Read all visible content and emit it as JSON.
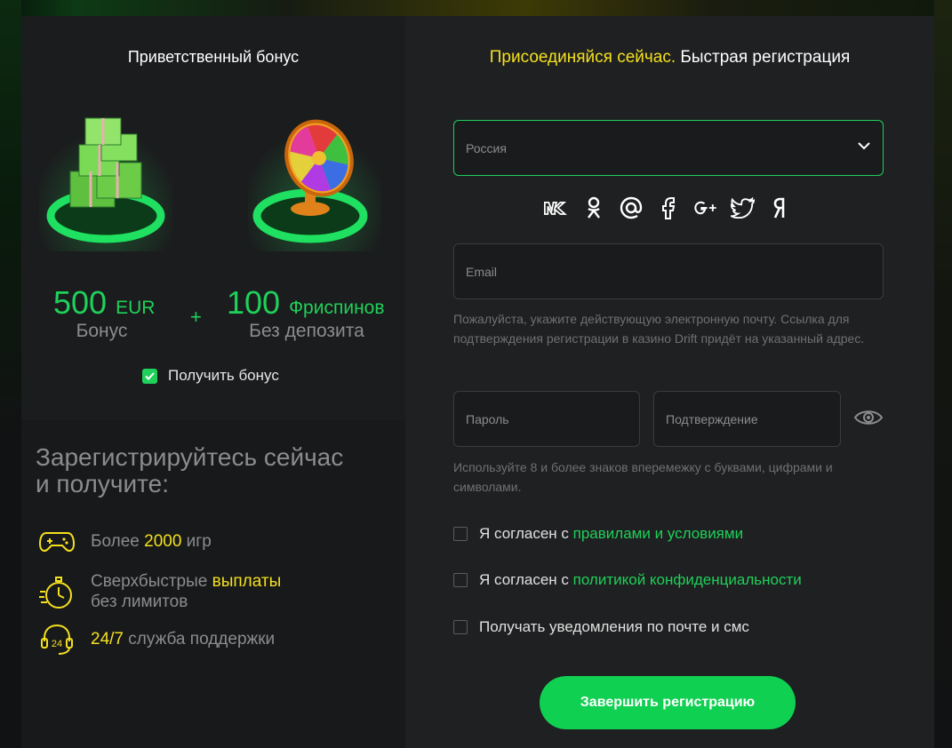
{
  "bonus": {
    "title": "Приветственный бонус",
    "bonus_amount": "500",
    "bonus_unit": "EUR",
    "bonus_sub": "Бонус",
    "plus": "+",
    "spins_amount": "100",
    "spins_unit": "Фриспинов",
    "spins_sub": "Без депозита",
    "get_bonus_label": "Получить бонус",
    "get_bonus_checked": true
  },
  "promo": {
    "title_line1": "Зарегистрируйтесь сейчас",
    "title_line2": "и получите:",
    "features": [
      {
        "icon": "gamepad-icon",
        "pre": "Более ",
        "highlight": "2000",
        "post": " игр"
      },
      {
        "icon": "stopwatch-icon",
        "pre": "Сверхбыстрые ",
        "highlight": "выплаты",
        "line2": "без лимитов"
      },
      {
        "icon": "support-24-icon",
        "highlight": "24/7",
        "post": " служба поддержки"
      }
    ]
  },
  "form": {
    "title_highlight": "Присоединяйся сейчас.",
    "title_rest": " Быстрая регистрация",
    "country_value": "Россия",
    "socials": [
      "vk-icon",
      "odnoklassniki-icon",
      "mailru-icon",
      "facebook-icon",
      "google-plus-icon",
      "twitter-icon",
      "yandex-icon"
    ],
    "email_placeholder": "Email",
    "email_hint": "Пожалуйста, укажите действующую электронную почту. Ссылка для подтверждения регистрации в казино Drift придёт на указанный адрес.",
    "password_placeholder": "Пароль",
    "confirm_placeholder": "Подтверждение",
    "password_hint": "Используйте 8 и более знаков вперемежку с буквами, цифрами и символами.",
    "agree_rules_pre": "Я согласен с ",
    "agree_rules_link": "правилами и условиями",
    "agree_privacy_pre": "Я согласен с ",
    "agree_privacy_link": "политикой конфиденциальности",
    "notify_label": "Получать уведомления по почте и смс",
    "submit_label": "Завершить регистрацию"
  },
  "colors": {
    "accent_green": "#1fd05a",
    "accent_yellow": "#f4e01f",
    "bg_dark": "#141516"
  }
}
